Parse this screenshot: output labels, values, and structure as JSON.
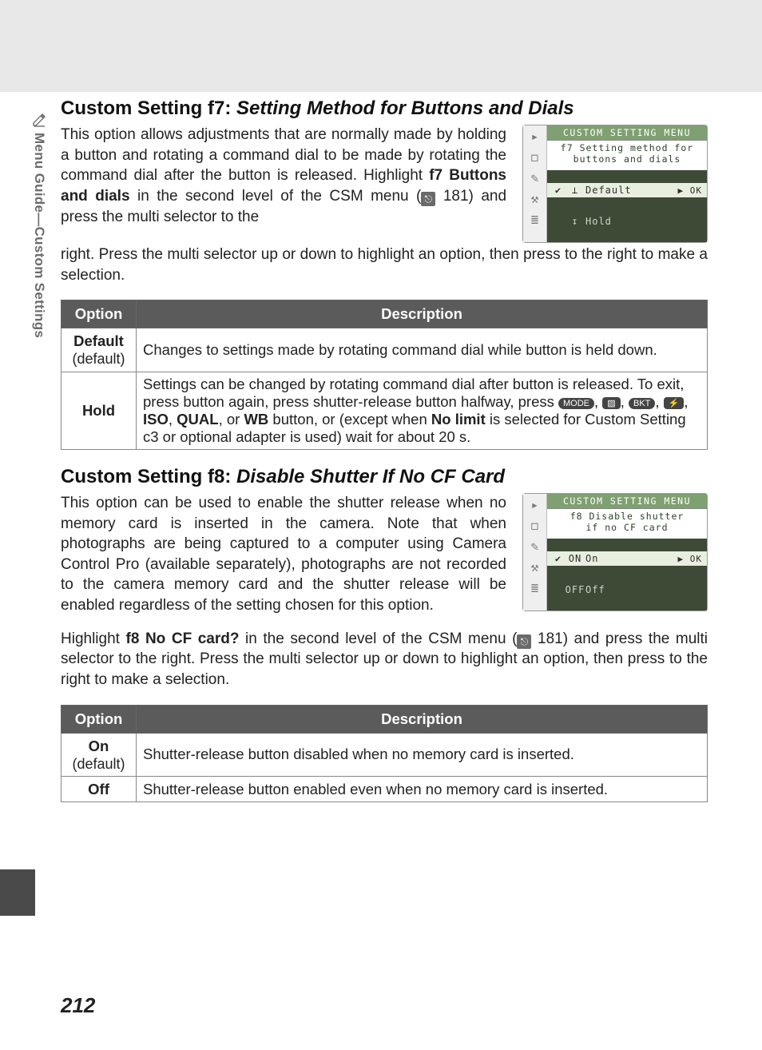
{
  "sideTab": "Menu Guide—Custom Settings",
  "pageNumber": "212",
  "sectionF7": {
    "headingLabel": "Custom Setting f7: ",
    "headingTitle": "Setting Method for Buttons and Dials",
    "para1a": "This option allows adjustments that are normally made by holding a button and rotating a command dial to be made by rotating the command dial after the button is released.  Highlight ",
    "para1bold": "f7 Buttons and dials",
    "para1b": " in the second level of the CSM menu (",
    "pageRef": "181",
    "para1c": ") and press the multi selector to the right.  Press the multi selector up or down to highlight an option, then press to the right to make a selection.",
    "camTitle": "CUSTOM SETTING MENU",
    "camSubL1": "f7  Setting method for",
    "camSubL2": "buttons and dials",
    "camOpt1Sym": "⊥",
    "camOpt1": "Default",
    "camOpt2Sym": "↧",
    "camOpt2": "Hold",
    "ok": "▶ OK",
    "tableHeadOption": "Option",
    "tableHeadDesc": "Description",
    "row1Opt": "Default",
    "row1Sub": "(default)",
    "row1Desc": "Changes to settings made by rotating command dial while button is held down.",
    "row2Opt": "Hold",
    "row2DescA": "Settings can be changed by rotating command dial after button is released.  To exit, press button again, press shutter-release button halfway, press ",
    "row2DescB": ", ",
    "row2DescC": ", ",
    "row2DescD": ", ",
    "row2DescE": ", ",
    "row2ISO": "ISO",
    "row2QUAL": "QUAL",
    "row2or": ", or ",
    "row2WB": "WB",
    "row2DescF": " button, or (except when ",
    "row2NoLimit": "No limit",
    "row2DescG": " is selected for Custom Setting c3 or optional adapter is used) wait for about 20 s."
  },
  "sectionF8": {
    "headingLabel": "Custom Setting f8: ",
    "headingTitle": "Disable Shutter If No CF Card",
    "para": "This option can be used to enable the shutter release when no memory card is inserted in the camera.  Note that when photographs are being captured to a computer using Camera Control Pro (available separately), photographs are not recorded to the camera memory card and the shutter release will be enabled regardless of the setting chosen for this option.",
    "para2a": "Highlight ",
    "para2bold": "f8 No CF card?",
    "para2b": " in the second level of the CSM menu (",
    "pageRef": "181",
    "para2c": ") and press the multi selector to the right.  Press the multi selector up or down to highlight an option, then press to the right to make a selection.",
    "camTitle": "CUSTOM SETTING MENU",
    "camSubL1": "f8  Disable shutter",
    "camSubL2": "if no CF card",
    "camOpt1Sym": "ON",
    "camOpt1": "On",
    "camOpt2Sym": "OFF",
    "camOpt2": "Off",
    "ok": "▶ OK",
    "tableHeadOption": "Option",
    "tableHeadDesc": "Description",
    "row1Opt": "On",
    "row1Sub": "(default)",
    "row1Desc": "Shutter-release button disabled when no memory card is inserted.",
    "row2Opt": "Off",
    "row2Desc": "Shutter-release button enabled even when no memory card is inserted."
  }
}
